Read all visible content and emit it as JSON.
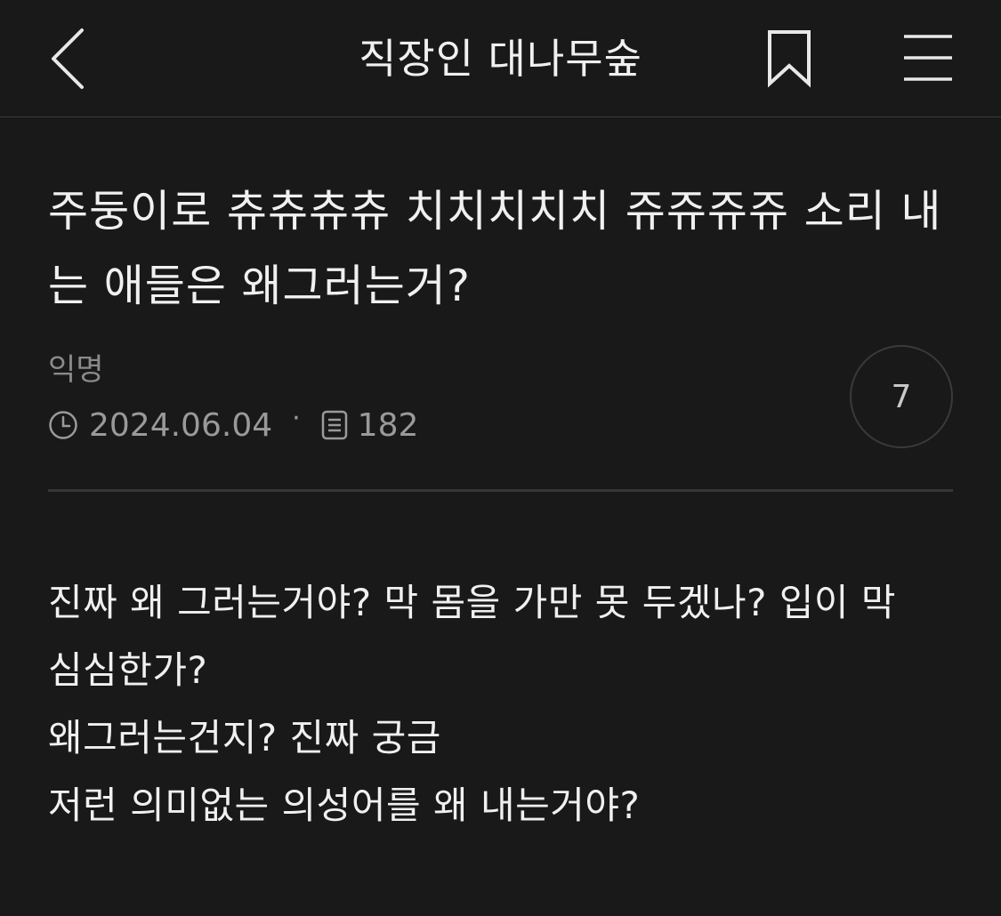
{
  "header": {
    "title": "직장인 대나무숲"
  },
  "post": {
    "title": "주둥이로 츄츄츄츄 치치치치치 쥬쥬쥬쥬 소리 내는 애들은 왜그러는거?",
    "author": "익명",
    "date": "2024.06.04",
    "separator": "·",
    "views": "182",
    "comment_count": "7",
    "body_lines": [
      "진짜 왜 그러는거야? 막 몸을 가만 못 두겠나? 입이 막",
      "심심한가?",
      "왜그러는건지? 진짜 궁금",
      "저런 의미없는 의성어를 왜 내는거야?"
    ]
  },
  "icons": {
    "back": "chevron-left-icon",
    "bookmark": "bookmark-icon",
    "menu": "hamburger-menu-icon",
    "clock": "clock-icon",
    "views": "document-icon"
  },
  "colors": {
    "background": "#191919",
    "text": "#f0f0f0",
    "muted": "#9a9a9a",
    "divider": "#363636"
  }
}
